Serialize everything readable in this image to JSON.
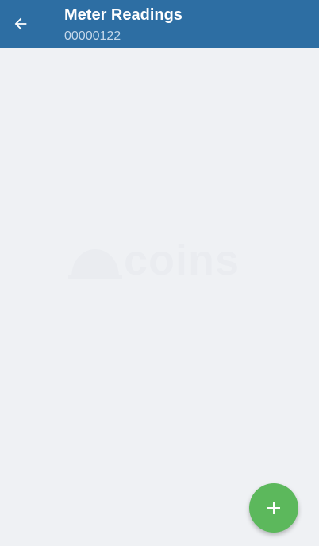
{
  "header": {
    "title": "Meter Readings",
    "subtitle": "00000122",
    "back_icon": "arrow-left-icon"
  },
  "watermark": {
    "text": "coins"
  },
  "fab": {
    "icon": "plus-icon",
    "color": "#5cb85c"
  },
  "colors": {
    "app_bar": "#2d6ea3",
    "background": "#eff1f4"
  }
}
